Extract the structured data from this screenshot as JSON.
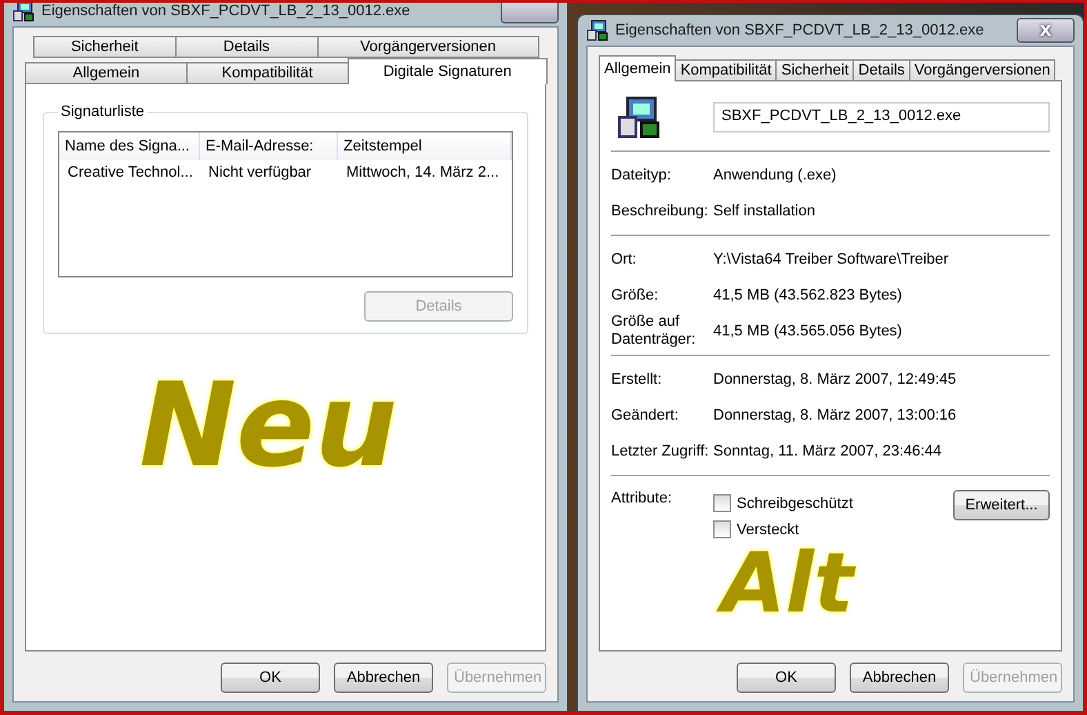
{
  "left_window": {
    "title": "Eigenschaften von SBXF_PCDVT_LB_2_13_0012.exe",
    "tab_rows": [
      [
        {
          "label": "Sicherheit",
          "selected": false
        },
        {
          "label": "Details",
          "selected": false
        },
        {
          "label": "Vorgängerversionen",
          "selected": false
        }
      ],
      [
        {
          "label": "Allgemein",
          "selected": false
        },
        {
          "label": "Kompatibilität",
          "selected": false
        },
        {
          "label": "Digitale Signaturen",
          "selected": true
        }
      ]
    ],
    "group": {
      "title": "Signaturliste",
      "columns": [
        "Name des Signa...",
        "E-Mail-Adresse:",
        "Zeitstempel"
      ],
      "rows": [
        [
          "Creative Technol...",
          "Nicht verfügbar",
          "Mittwoch, 14. März 2..."
        ]
      ],
      "button": {
        "label": "Details",
        "disabled": true
      }
    },
    "annotation": "Neu",
    "buttons": [
      {
        "label": "OK",
        "disabled": false
      },
      {
        "label": "Abbrechen",
        "disabled": false
      },
      {
        "label": "Übernehmen",
        "disabled": true
      }
    ]
  },
  "right_window": {
    "title": "Eigenschaften von SBXF_PCDVT_LB_2_13_0012.exe",
    "close": "X",
    "tabs": [
      {
        "label": "Allgemein",
        "selected": true
      },
      {
        "label": "Kompatibilität",
        "selected": false
      },
      {
        "label": "Sicherheit",
        "selected": false
      },
      {
        "label": "Details",
        "selected": false
      },
      {
        "label": "Vorgängerversionen",
        "selected": false
      }
    ],
    "file_name": "SBXF_PCDVT_LB_2_13_0012.exe",
    "sections": [
      [
        {
          "label": "Dateityp:",
          "value": "Anwendung (.exe)"
        },
        {
          "label": "Beschreibung:",
          "value": "Self installation"
        }
      ],
      [
        {
          "label": "Ort:",
          "value": "Y:\\Vista64 Treiber Software\\Treiber"
        },
        {
          "label": "Größe:",
          "value": "41,5 MB (43.562.823 Bytes)"
        },
        {
          "label": "Größe auf Datenträger:",
          "value": "41,5 MB (43.565.056 Bytes)"
        }
      ],
      [
        {
          "label": "Erstellt:",
          "value": "Donnerstag, 8. März 2007, 12:49:45"
        },
        {
          "label": "Geändert:",
          "value": "Donnerstag, 8. März 2007, 13:00:16"
        },
        {
          "label": "Letzter Zugriff:",
          "value": "Sonntag, 11. März 2007, 23:46:44"
        }
      ]
    ],
    "attributes": {
      "label": "Attribute:",
      "checkboxes": [
        {
          "label": "Schreibgeschützt",
          "checked": false
        },
        {
          "label": "Versteckt",
          "checked": false
        }
      ],
      "button": {
        "label": "Erweitert...",
        "disabled": false
      }
    },
    "annotation": "Alt",
    "buttons": [
      {
        "label": "OK",
        "disabled": false
      },
      {
        "label": "Abbrechen",
        "disabled": false
      },
      {
        "label": "Übernehmen",
        "disabled": true
      }
    ]
  }
}
